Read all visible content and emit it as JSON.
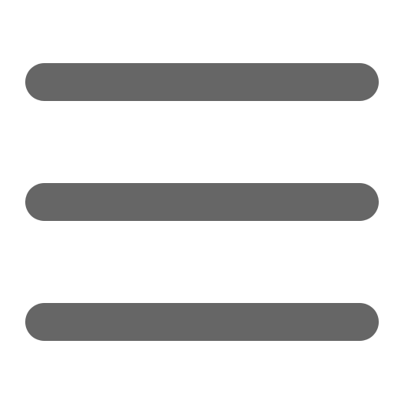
{
  "menu_button": {
    "icon": "hamburger-menu-icon",
    "bar_color": "#666666",
    "background_color": "#ffffff"
  }
}
